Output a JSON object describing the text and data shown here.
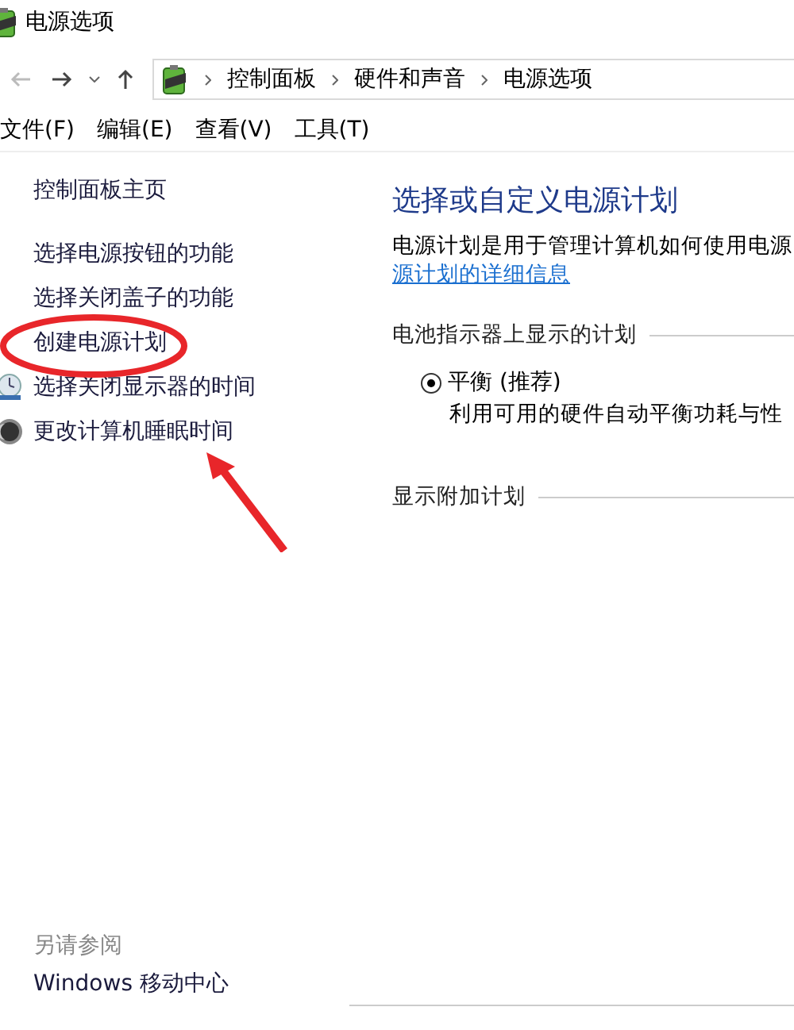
{
  "window": {
    "title": "电源选项"
  },
  "nav": {
    "breadcrumbs": [
      "控制面板",
      "硬件和声音",
      "电源选项"
    ]
  },
  "menu": [
    "文件(F)",
    "编辑(E)",
    "查看(V)",
    "工具(T)"
  ],
  "sidebar": {
    "home": "控制面板主页",
    "items": [
      {
        "label": "选择电源按钮的功能",
        "kind": "plain"
      },
      {
        "label": "选择关闭盖子的功能",
        "kind": "plain"
      },
      {
        "label": "创建电源计划",
        "kind": "plain"
      },
      {
        "label": "选择关闭显示器的时间",
        "kind": "monitor"
      },
      {
        "label": "更改计算机睡眠时间",
        "kind": "moon"
      }
    ],
    "see_also": {
      "title": "另请参阅",
      "items": [
        "Windows 移动中心"
      ]
    }
  },
  "main": {
    "heading": "选择或自定义电源计划",
    "intro": "电源计划是用于管理计算机如何使用电源",
    "link": "源计划的详细信息",
    "sections": [
      {
        "title": "电池指示器上显示的计划",
        "plans": [
          {
            "name": "平衡 (推荐)",
            "description": "利用可用的硬件自动平衡功耗与性",
            "selected": true
          }
        ]
      },
      {
        "title": "显示附加计划"
      }
    ]
  }
}
